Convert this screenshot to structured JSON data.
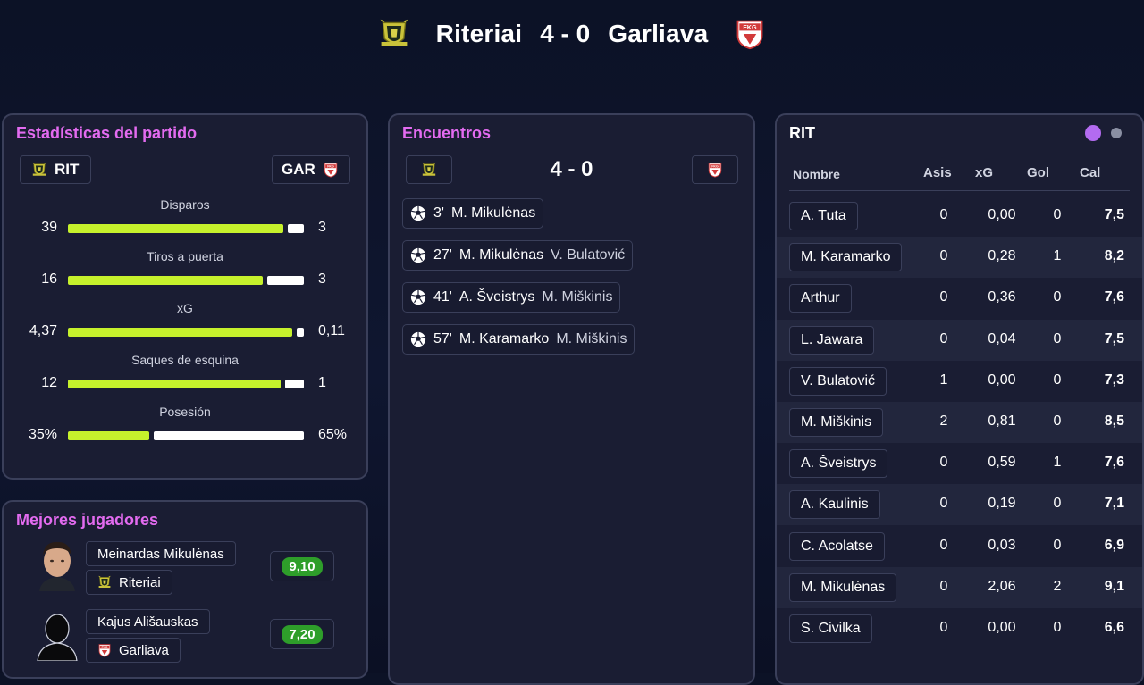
{
  "match": {
    "home": "Riteriai",
    "away": "Garliava",
    "score": "4 - 0",
    "home_abbr": "RIT",
    "away_abbr": "GAR"
  },
  "stats_panel": {
    "title": "Estadísticas del partido",
    "stats": [
      {
        "label": "Disparos",
        "home": "39",
        "away": "3",
        "home_share": 0.93
      },
      {
        "label": "Tiros a puerta",
        "home": "16",
        "away": "3",
        "home_share": 0.84
      },
      {
        "label": "xG",
        "home": "4,37",
        "away": "0,11",
        "home_share": 0.97
      },
      {
        "label": "Saques de esquina",
        "home": "12",
        "away": "1",
        "home_share": 0.92
      },
      {
        "label": "Posesión",
        "home": "35%",
        "away": "65%",
        "home_share": 0.35
      }
    ]
  },
  "best_players": {
    "title": "Mejores jugadores",
    "players": [
      {
        "name": "Meinardas Mikulėnas",
        "team": "Riteriai",
        "rating": "9,10"
      },
      {
        "name": "Kajus Ališauskas",
        "team": "Garliava",
        "rating": "7,20"
      }
    ]
  },
  "encounters": {
    "title": "Encuentros",
    "score": "4 - 0",
    "events": [
      {
        "minute": "3'",
        "scorer": "M. Mikulėnas",
        "assist": ""
      },
      {
        "minute": "27'",
        "scorer": "M. Mikulėnas",
        "assist": "V. Bulatović"
      },
      {
        "minute": "41'",
        "scorer": "A. Šveistrys",
        "assist": "M. Miškinis"
      },
      {
        "minute": "57'",
        "scorer": "M. Karamarko",
        "assist": "M. Miškinis"
      }
    ]
  },
  "lineup": {
    "title": "RIT",
    "headers": {
      "name": "Nombre",
      "assists": "Asis",
      "xg": "xG",
      "goals": "Gol",
      "rating": "Cal"
    },
    "toggle_active_color": "#b36bf0",
    "toggle_inactive_color": "#8a8fa3",
    "players": [
      {
        "name": "A. Tuta",
        "assists": "0",
        "xg": "0,00",
        "goals": "0",
        "rating": "7,5"
      },
      {
        "name": "M. Karamarko",
        "assists": "0",
        "xg": "0,28",
        "goals": "1",
        "rating": "8,2"
      },
      {
        "name": "Arthur",
        "assists": "0",
        "xg": "0,36",
        "goals": "0",
        "rating": "7,6"
      },
      {
        "name": "L. Jawara",
        "assists": "0",
        "xg": "0,04",
        "goals": "0",
        "rating": "7,5"
      },
      {
        "name": "V. Bulatović",
        "assists": "1",
        "xg": "0,00",
        "goals": "0",
        "rating": "7,3"
      },
      {
        "name": "M. Miškinis",
        "assists": "2",
        "xg": "0,81",
        "goals": "0",
        "rating": "8,5"
      },
      {
        "name": "A. Šveistrys",
        "assists": "0",
        "xg": "0,59",
        "goals": "1",
        "rating": "7,6"
      },
      {
        "name": "A. Kaulinis",
        "assists": "0",
        "xg": "0,19",
        "goals": "0",
        "rating": "7,1"
      },
      {
        "name": "C. Acolatse",
        "assists": "0",
        "xg": "0,03",
        "goals": "0",
        "rating": "6,9"
      },
      {
        "name": "M. Mikulėnas",
        "assists": "0",
        "xg": "2,06",
        "goals": "2",
        "rating": "9,1"
      },
      {
        "name": "S. Civilka",
        "assists": "0",
        "xg": "0,00",
        "goals": "0",
        "rating": "6,6"
      }
    ]
  },
  "colors": {
    "accent_title": "#e36bf0",
    "home_bar": "#c6f12c",
    "away_bar": "#ffffff",
    "rating_badge": "#2e9e2a"
  },
  "icons": {
    "home_crest": "riteriai-crest-icon",
    "away_crest": "garliava-crest-icon",
    "goal": "soccer-ball-icon"
  }
}
